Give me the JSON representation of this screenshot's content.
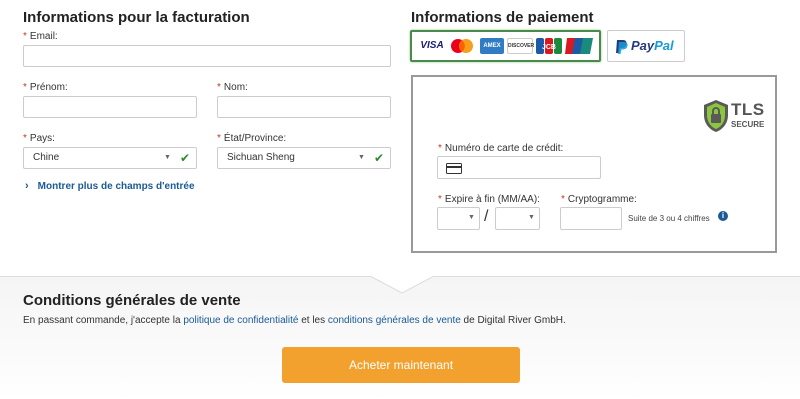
{
  "billing": {
    "title": "Informations pour la facturation",
    "required_mark": "*",
    "email_label": "Email:",
    "email_value": "",
    "firstname_label": "Prénom:",
    "firstname_value": "",
    "lastname_label": "Nom:",
    "lastname_value": "",
    "country_label": "Pays:",
    "country_value": "Chine",
    "state_label": "État/Province:",
    "state_value": "Sichuan Sheng",
    "show_more": "Montrer plus de champs d'entrée"
  },
  "payment": {
    "title": "Informations de paiement",
    "tabs": [
      {
        "name": "cards",
        "logos": [
          "VISA",
          "Mastercard",
          "AMEX",
          "DISCOVER",
          "JCB",
          "UnionPay"
        ]
      },
      {
        "name": "paypal",
        "label_pay": "Pay",
        "label_pal": "Pal"
      }
    ],
    "tls_badge_line1": "TLS",
    "tls_badge_line2": "SECURE",
    "card_number_label": "Numéro de carte de crédit:",
    "card_number_value": "",
    "expiry_label": "Expire à fin (MM/AA):",
    "expiry_month": "",
    "expiry_year": "",
    "expiry_separator": "/",
    "cvv_label": "Cryptogramme:",
    "cvv_value": "",
    "cvv_hint": "Suite de 3 ou 4 chiffres"
  },
  "terms": {
    "title": "Conditions générales de vente",
    "text_before": "En passant commande, j'accepte la ",
    "link_privacy": "politique de confidentialité",
    "text_middle": " et les ",
    "link_terms": "conditions générales de vente",
    "text_after": " de Digital River GmbH."
  },
  "buy_button": "Acheter maintenant",
  "colors": {
    "accent_orange": "#f2a12e",
    "link_blue": "#1a5a96",
    "valid_green": "#2d8a2d",
    "required_red": "#c0392b"
  }
}
